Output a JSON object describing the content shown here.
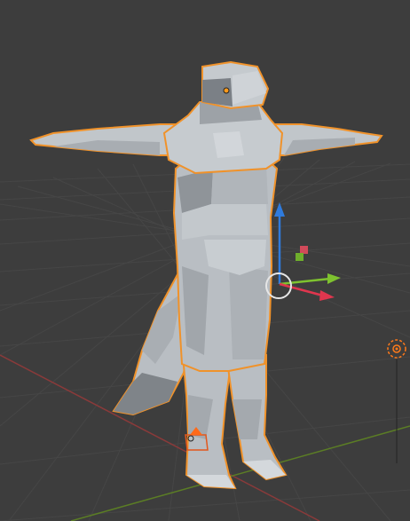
{
  "viewport": {
    "background": "#3d3d3d",
    "grid_color": "#464646",
    "x_axis_color": "#8a3a3a",
    "y_axis_color": "#5b7d25"
  },
  "mesh": {
    "fill": "#b9bec3",
    "shade": "#9ea3a8",
    "dark": "#7f8489",
    "outline_color": "#f0922a",
    "origin_color": "#ff9a1a"
  },
  "gizmo": {
    "z_color": "#2f7bdd",
    "y_color": "#7ec22f",
    "x_color": "#e0364e",
    "ring_color": "#e6e6e6"
  },
  "objects": {
    "light_color": "#ff7a1a",
    "camera_color": "#e2571c"
  }
}
